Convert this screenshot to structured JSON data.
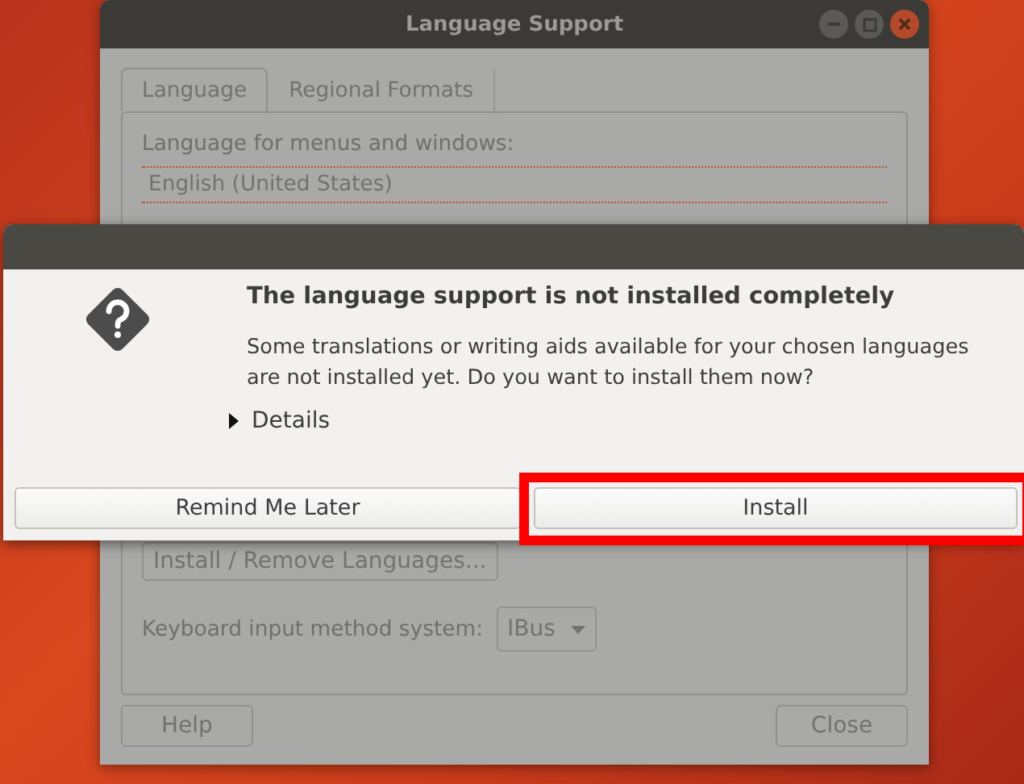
{
  "window": {
    "title": "Language Support"
  },
  "tabs": [
    {
      "label": "Language",
      "selected": true
    },
    {
      "label": "Regional Formats",
      "selected": false
    }
  ],
  "language_label": "Language for menus and windows:",
  "languages": [
    "English (United States)"
  ],
  "install_remove_button": "Install / Remove Languages...",
  "keyboard": {
    "label": "Keyboard input method system:",
    "value": "IBus"
  },
  "footer_buttons": [
    "Help",
    "Close"
  ],
  "dialog": {
    "heading": "The language support is not installed completely",
    "message": "Some translations or writing aids available for your chosen languages are not installed yet. Do you want to install them now?",
    "details": {
      "label": "Details",
      "expanded": false
    },
    "buttons": [
      {
        "label": "Remind Me Later",
        "highlighted": false
      },
      {
        "label": "Install",
        "highlighted": true
      }
    ]
  }
}
